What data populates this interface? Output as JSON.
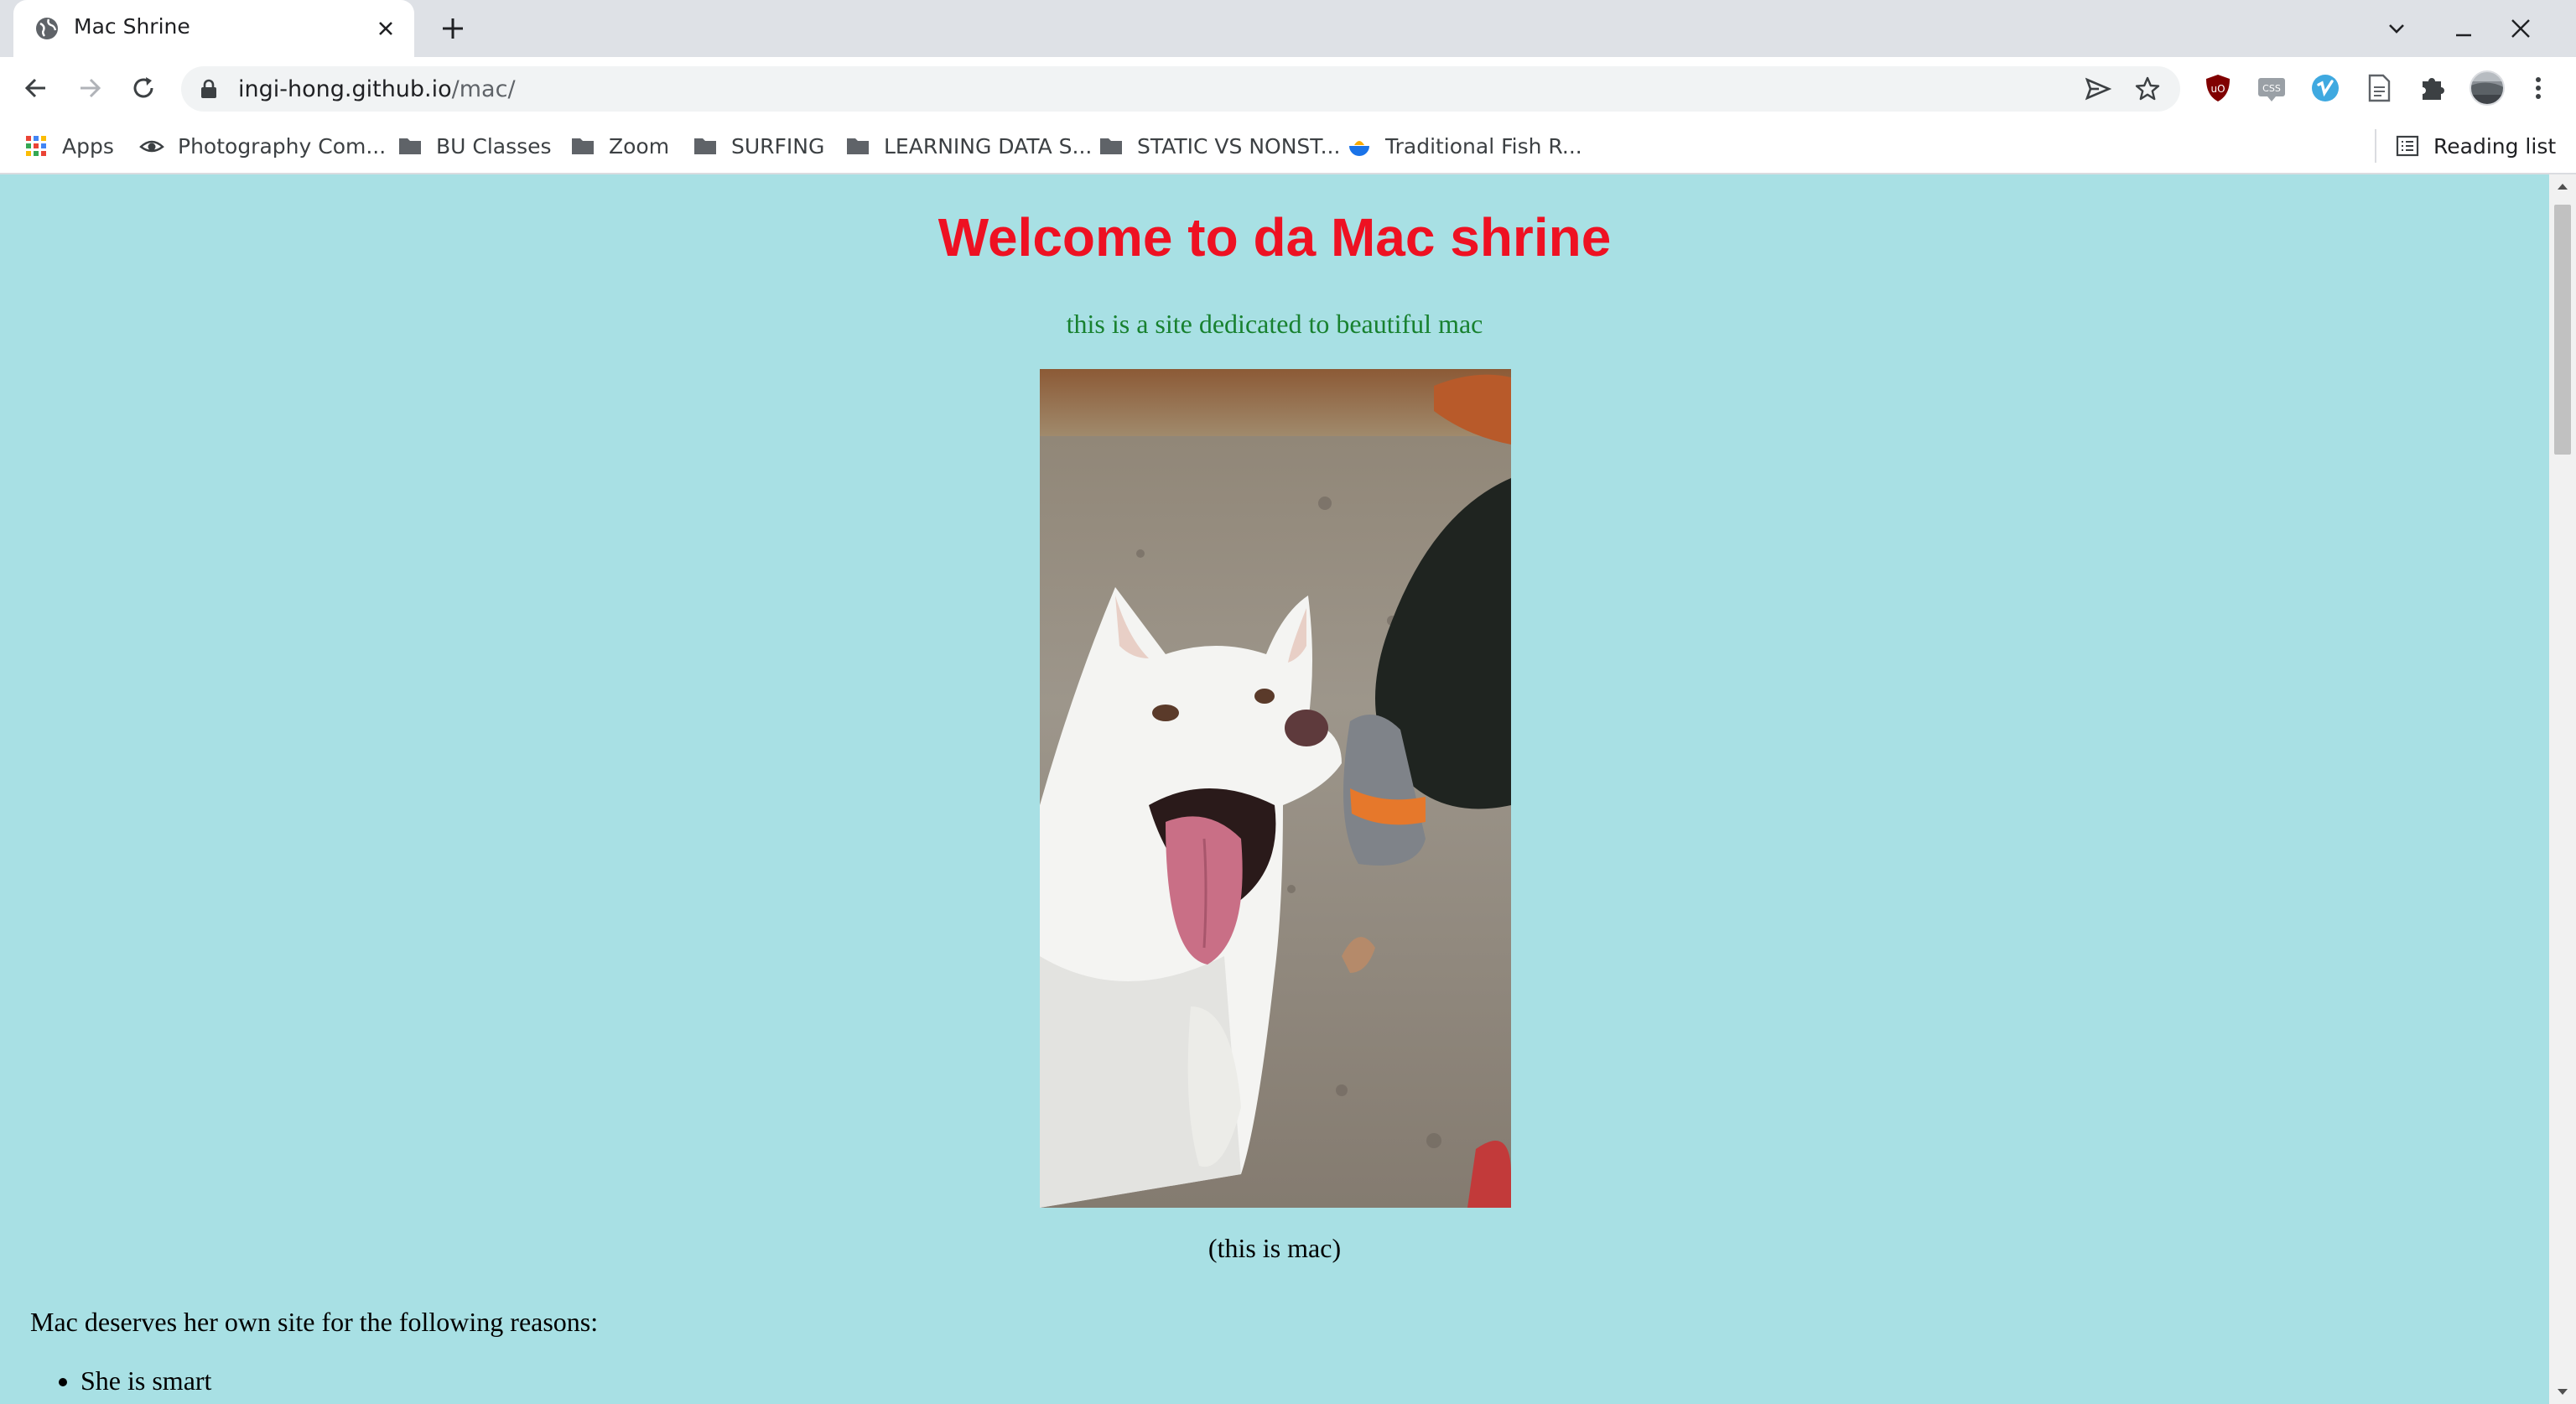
{
  "browser": {
    "tab": {
      "title": "Mac Shrine",
      "favicon": "globe-icon"
    },
    "address": {
      "host": "ingi-hong.github.io",
      "path": "/mac/"
    },
    "bookmarks": [
      {
        "label": "Apps",
        "icon": "apps-grid-icon"
      },
      {
        "label": "Photography Com...",
        "icon": "eye-icon"
      },
      {
        "label": "BU Classes",
        "icon": "folder-icon"
      },
      {
        "label": "Zoom",
        "icon": "folder-icon"
      },
      {
        "label": "SURFING",
        "icon": "folder-icon"
      },
      {
        "label": "LEARNING DATA S...",
        "icon": "folder-icon"
      },
      {
        "label": "STATIC VS NONST...",
        "icon": "folder-icon"
      },
      {
        "label": "Traditional Fish R...",
        "icon": "fish-bowl-icon"
      }
    ],
    "reading_list": {
      "label": "Reading list",
      "icon": "reading-list-icon"
    },
    "extensions": [
      "ublock-icon",
      "css-viewer-icon",
      "vimeo-icon",
      "document-icon",
      "puzzle-icon",
      "profile-avatar-icon",
      "menu-icon"
    ]
  },
  "page": {
    "title": "Welcome to da Mac shrine",
    "subtitle": "this is a site dedicated to beautiful mac",
    "photo_alt": "mac",
    "caption": "(this is mac)",
    "intro": "Mac deserves her own site for the following reasons:",
    "reasons": [
      "She is smart"
    ]
  },
  "colors": {
    "page_bg": "#a8e0e4",
    "title": "#ee1122",
    "subtitle": "#18812f"
  }
}
